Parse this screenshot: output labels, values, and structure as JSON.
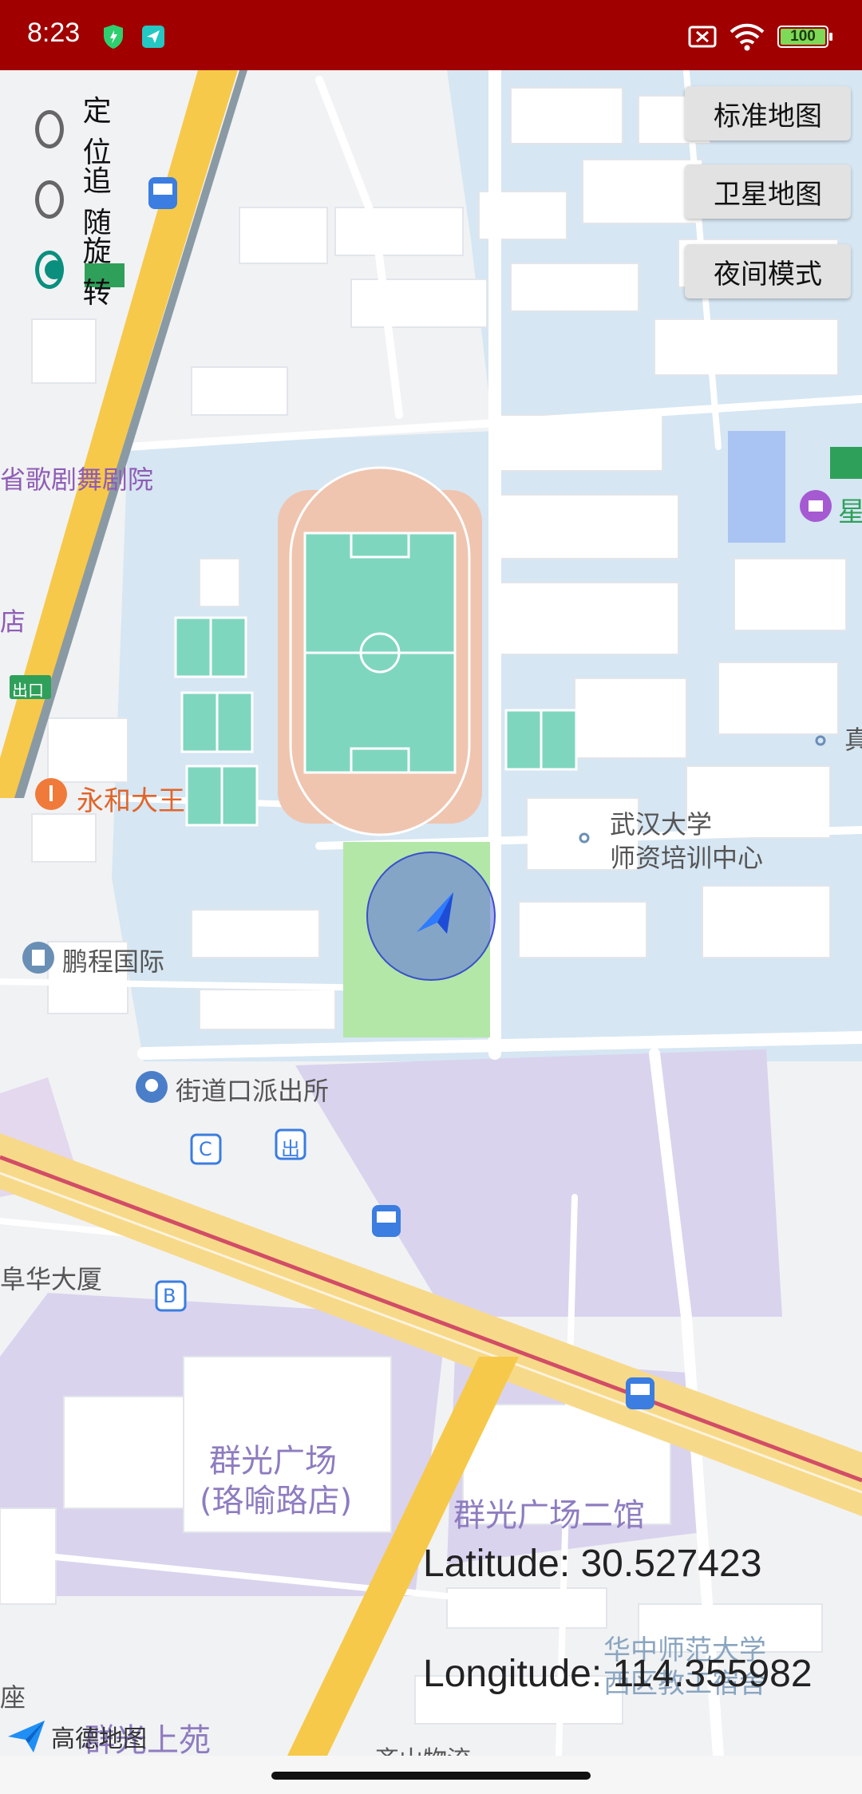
{
  "status_bar": {
    "time": "8:23",
    "battery": "100",
    "icons": [
      "shield-icon",
      "paper-plane-icon",
      "sim-off-icon",
      "wifi-icon",
      "battery-icon"
    ]
  },
  "location_modes": [
    {
      "label": "定位",
      "selected": false
    },
    {
      "label": "追随",
      "selected": false
    },
    {
      "label": "旋转",
      "selected": true
    }
  ],
  "map_type_buttons": {
    "standard": "标准地图",
    "satellite": "卫星地图",
    "night": "夜间模式"
  },
  "coordinates": {
    "latitude": "Latitude: 30.527423",
    "longitude": "Longitude: 114.355982"
  },
  "map_labels": {
    "opera": "省歌剧舞剧院",
    "store_edge": "店",
    "exit_sign": "出口",
    "restaurant": "永和大王",
    "whu_line1": "武汉大学",
    "whu_line2": "师资培训中心",
    "pengcheng": "鹏程国际",
    "police": "街道口派出所",
    "c_exit": "C",
    "chu_exit": "出",
    "b_exit": "B",
    "fuhua": "阜华大厦",
    "qunguang_line1": "群光广场",
    "qunguang_line2": "(珞喻路店)",
    "qunguang2": "群光广场二馆",
    "hzsf_line1": "华中师范大学",
    "hzsf_line2": "西区教工宿舍",
    "qunguang_shangyuan": "群光上苑",
    "qishan": "齐山物流",
    "zuo": "座",
    "zhen": "真",
    "xing": "星"
  },
  "amap_logo": "高德地图",
  "colors": {
    "status_bar": "#a00000",
    "radio_selected": "#0a8f7e",
    "campus_blue": "#d6e6f3",
    "building": "#ffffff",
    "field_green": "#7fd6bf",
    "track": "#efc5b0",
    "road_yellow": "#f7c94a",
    "commercial_purple": "#d9d3ee",
    "location_circle": "#5c6fdc",
    "location_arrow": "#2f7bff"
  }
}
